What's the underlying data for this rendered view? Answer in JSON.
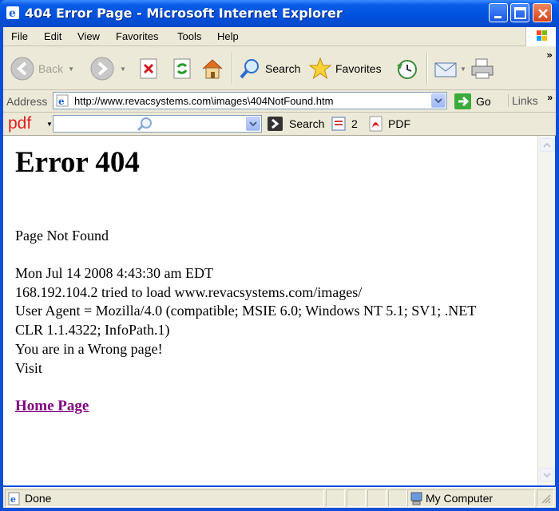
{
  "window": {
    "title": "404 Error Page - Microsoft Internet Explorer"
  },
  "menu": [
    "File",
    "Edit",
    "View",
    "Favorites",
    "Tools",
    "Help"
  ],
  "toolbar": {
    "back_label": "Back",
    "search_label": "Search",
    "favorites_label": "Favorites"
  },
  "address": {
    "label": "Address",
    "url": "http://www.revacsystems.com\\images\\404NotFound.htm",
    "go_label": "Go",
    "links_label": "Links"
  },
  "pdf_toolbar": {
    "logo": "pdf",
    "search_label": "Search",
    "count": "2",
    "pdf_label": "PDF"
  },
  "page": {
    "heading": "Error 404",
    "subtitle": "Page Not Found",
    "timestamp": "Mon Jul 14 2008 4:43:30 am EDT",
    "load_line": "168.192.104.2 tried to load www.revacsystems.com/images/",
    "agent_line1": "User Agent = Mozilla/4.0 (compatible; MSIE 6.0; Windows NT 5.1; SV1; .NET",
    "agent_line2": "CLR 1.1.4322; InfoPath.1)",
    "wrong_page": "You are in a Wrong page!",
    "visit": "Visit",
    "home_link": "Home Page"
  },
  "status": {
    "text": "Done",
    "zone": "My Computer"
  },
  "colors": {
    "titlebar": "#0A5CE8",
    "link_visited": "#800080",
    "chrome": "#ECE9D8"
  }
}
